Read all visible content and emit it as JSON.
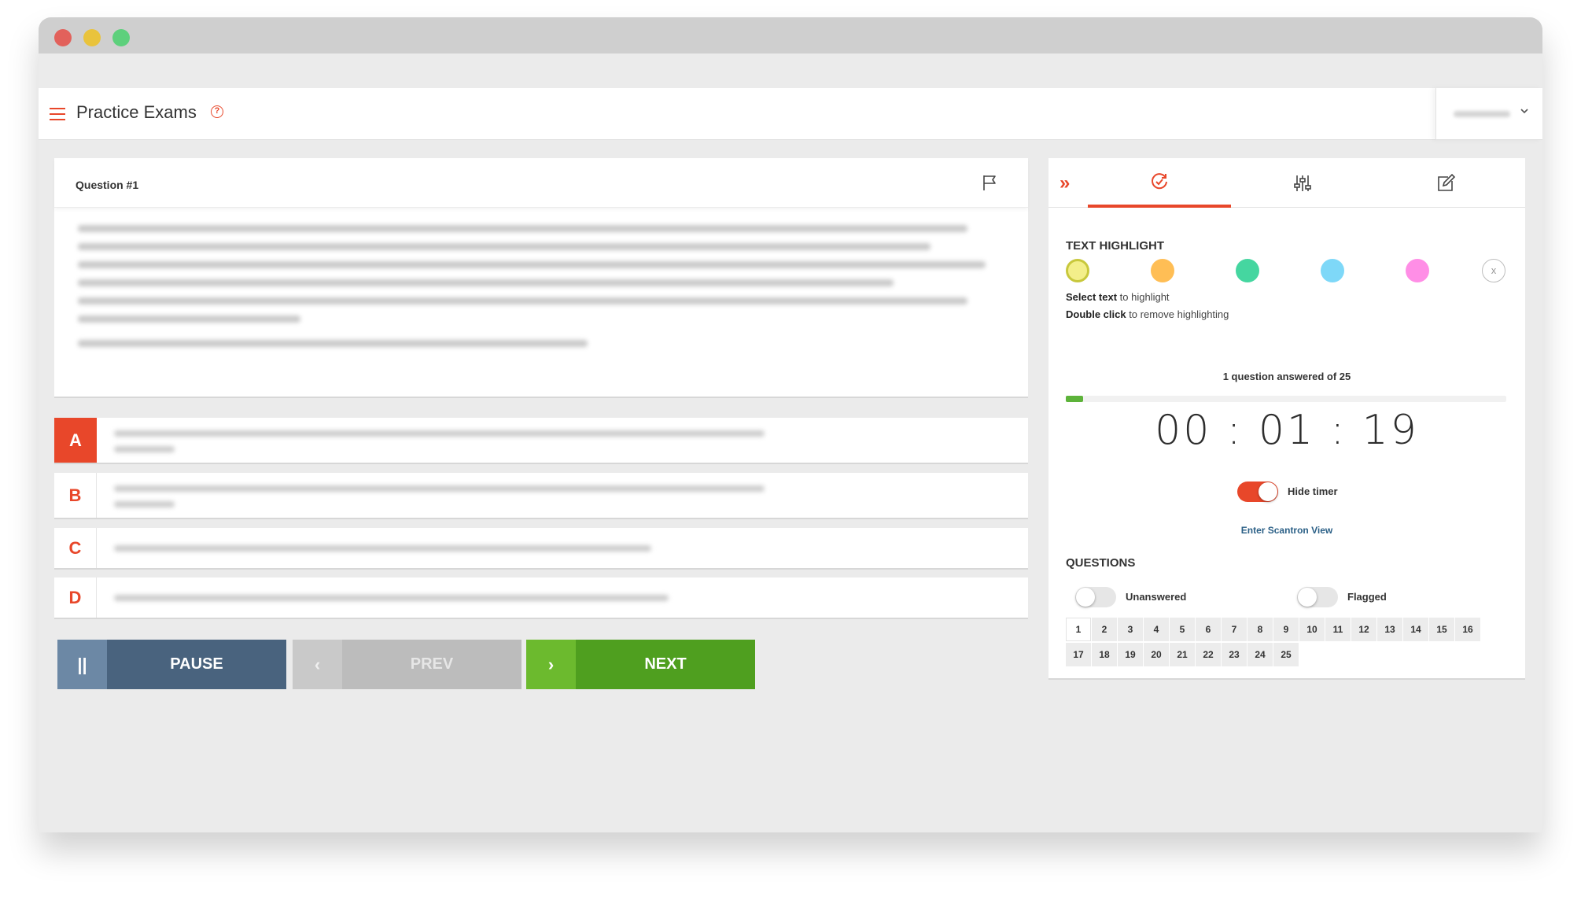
{
  "header": {
    "title": "Practice Exams",
    "help_glyph": "?",
    "user_chevron": "⌄"
  },
  "question": {
    "title": "Question #1",
    "flag_icon": "flag-icon"
  },
  "answers": [
    {
      "letter": "A",
      "selected": true
    },
    {
      "letter": "B",
      "selected": false
    },
    {
      "letter": "C",
      "selected": false
    },
    {
      "letter": "D",
      "selected": false
    }
  ],
  "controls": {
    "pause_label": "PAUSE",
    "pause_icon_glyph": "||",
    "prev_label": "PREV",
    "prev_icon_glyph": "‹",
    "next_label": "NEXT",
    "next_icon_glyph": "›"
  },
  "side": {
    "collapse_glyph": "»",
    "tabs": [
      {
        "icon": "refresh-icon",
        "active": true
      },
      {
        "icon": "sliders-icon",
        "active": false
      },
      {
        "icon": "edit-icon",
        "active": false
      }
    ],
    "highlight": {
      "label": "TEXT HIGHLIGHT",
      "colors": [
        "#f3ef8a",
        "#ffbe55",
        "#45d6a0",
        "#7ed8f8",
        "#ff8ee6"
      ],
      "clear_glyph": "x",
      "hint1_bold": "Select text",
      "hint1_rest": " to highlight",
      "hint2_bold": "Double click",
      "hint2_rest": " to remove highlighting"
    },
    "progress": {
      "text": "1 question answered of 25",
      "answered": 1,
      "total": 25
    },
    "timer": "00 : 01 : 19",
    "hide_timer": {
      "label": "Hide timer",
      "on": true
    },
    "scantron_label": "Enter Scantron View",
    "questions": {
      "label": "QUESTIONS",
      "filters": [
        {
          "label": "Unanswered",
          "on": false
        },
        {
          "label": "Flagged",
          "on": false
        }
      ],
      "numbers": [
        "1",
        "2",
        "3",
        "4",
        "5",
        "6",
        "7",
        "8",
        "9",
        "10",
        "11",
        "12",
        "13",
        "14",
        "15",
        "16",
        "17",
        "18",
        "19",
        "20",
        "21",
        "22",
        "23",
        "24",
        "25"
      ],
      "current": "1"
    }
  }
}
